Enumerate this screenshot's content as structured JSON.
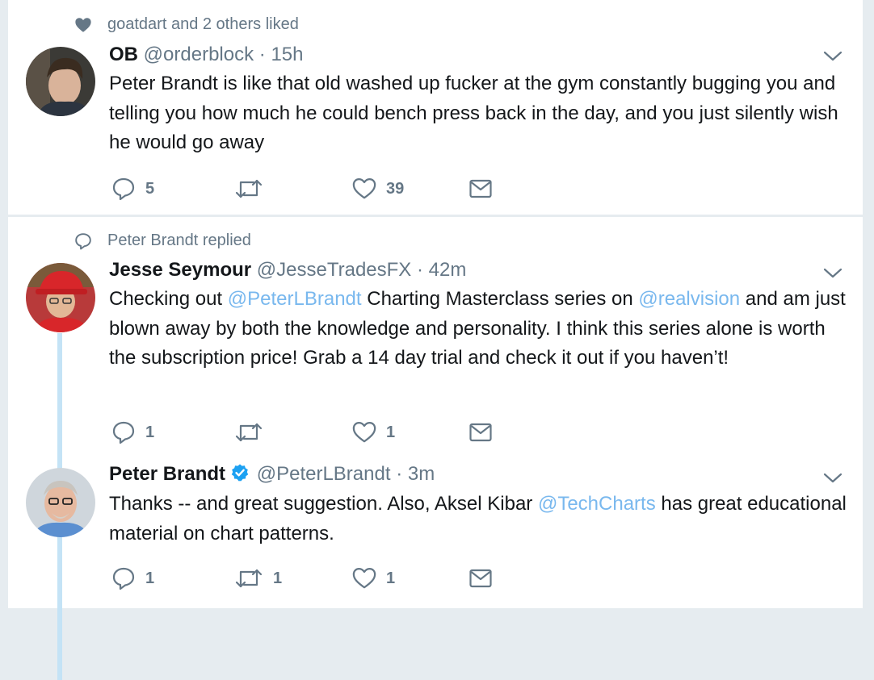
{
  "tweets": [
    {
      "context": {
        "icon": "heart-icon",
        "text": "goatdart and 2 others liked"
      },
      "name": "OB",
      "handle": "@orderblock",
      "dot": "·",
      "time": "15h",
      "verified": false,
      "text": "Peter Brandt is like that old washed up fucker at the gym constantly bugging you and telling you how much he could bench press back in the day, and you just silently wish he would go away",
      "actions": {
        "replies": "5",
        "retweets": "",
        "likes": "39"
      }
    },
    {
      "context": {
        "icon": "reply-icon",
        "text": "Peter Brandt replied"
      },
      "name": "Jesse Seymour",
      "handle": "@JesseTradesFX",
      "dot": "·",
      "time": "42m",
      "verified": false,
      "text_parts": {
        "a": "Checking out ",
        "mention1": "@PeterLBrandt",
        "b": " Charting Masterclass series on ",
        "mention2": "@realvision",
        "c": " and am just blown away by both the knowledge and personality.  I think this series alone is worth the subscription price!  Grab a 14 day trial and check it out if you haven’t!"
      },
      "actions": {
        "replies": "1",
        "retweets": "",
        "likes": "1"
      }
    },
    {
      "name": "Peter Brandt",
      "handle": "@PeterLBrandt",
      "dot": "·",
      "time": "3m",
      "verified": true,
      "text_parts": {
        "a": "Thanks -- and great suggestion. Also, Aksel Kibar ",
        "mention1": "@TechCharts",
        "b": " has great educational material on chart patterns."
      },
      "actions": {
        "replies": "1",
        "retweets": "1",
        "likes": "1"
      }
    }
  ],
  "colors": {
    "mention": "#79b8ee",
    "verified": "#1da1f2",
    "muted": "#657786",
    "thread_line": "#c4e3f6"
  }
}
